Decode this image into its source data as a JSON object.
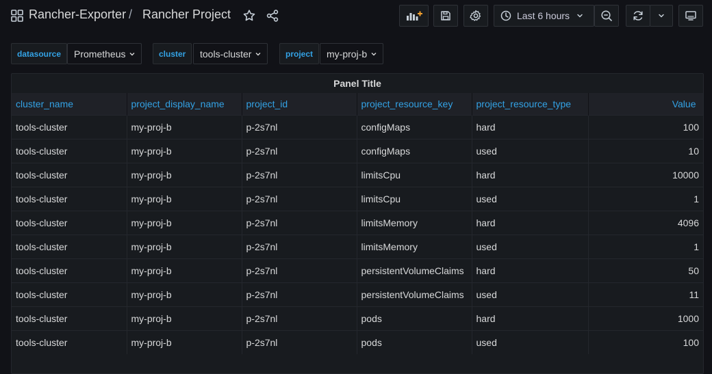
{
  "breadcrumb": {
    "folder": "Rancher-Exporter",
    "separator": "/",
    "dashboard": "Rancher Project"
  },
  "toolbar": {
    "time_range": "Last 6 hours"
  },
  "variables": [
    {
      "label": "datasource",
      "value": "Prometheus"
    },
    {
      "label": "cluster",
      "value": "tools-cluster"
    },
    {
      "label": "project",
      "value": "my-proj-b"
    }
  ],
  "panel": {
    "title": "Panel Title",
    "columns": [
      "cluster_name",
      "project_display_name",
      "project_id",
      "project_resource_key",
      "project_resource_type",
      "Value"
    ],
    "rows": [
      [
        "tools-cluster",
        "my-proj-b",
        "p-2s7nl",
        "configMaps",
        "hard",
        "100"
      ],
      [
        "tools-cluster",
        "my-proj-b",
        "p-2s7nl",
        "configMaps",
        "used",
        "10"
      ],
      [
        "tools-cluster",
        "my-proj-b",
        "p-2s7nl",
        "limitsCpu",
        "hard",
        "10000"
      ],
      [
        "tools-cluster",
        "my-proj-b",
        "p-2s7nl",
        "limitsCpu",
        "used",
        "1"
      ],
      [
        "tools-cluster",
        "my-proj-b",
        "p-2s7nl",
        "limitsMemory",
        "hard",
        "4096"
      ],
      [
        "tools-cluster",
        "my-proj-b",
        "p-2s7nl",
        "limitsMemory",
        "used",
        "1"
      ],
      [
        "tools-cluster",
        "my-proj-b",
        "p-2s7nl",
        "persistentVolumeClaims",
        "hard",
        "50"
      ],
      [
        "tools-cluster",
        "my-proj-b",
        "p-2s7nl",
        "persistentVolumeClaims",
        "used",
        "11"
      ],
      [
        "tools-cluster",
        "my-proj-b",
        "p-2s7nl",
        "pods",
        "hard",
        "1000"
      ],
      [
        "tools-cluster",
        "my-proj-b",
        "p-2s7nl",
        "pods",
        "used",
        "100"
      ]
    ]
  },
  "icons": {
    "apps": "apps-grid-icon",
    "star": "star-icon",
    "share": "share-icon",
    "add_panel": "add-panel-icon",
    "save": "save-icon",
    "settings": "gear-icon",
    "clock": "clock-icon",
    "zoom_out": "zoom-out-icon",
    "refresh": "refresh-icon",
    "tv_mode": "tv-mode-icon"
  },
  "colors": {
    "background": "#111217",
    "panel": "#181b1f",
    "link_blue": "#33a2e5",
    "add_panel_accent": "#f2a02f"
  }
}
